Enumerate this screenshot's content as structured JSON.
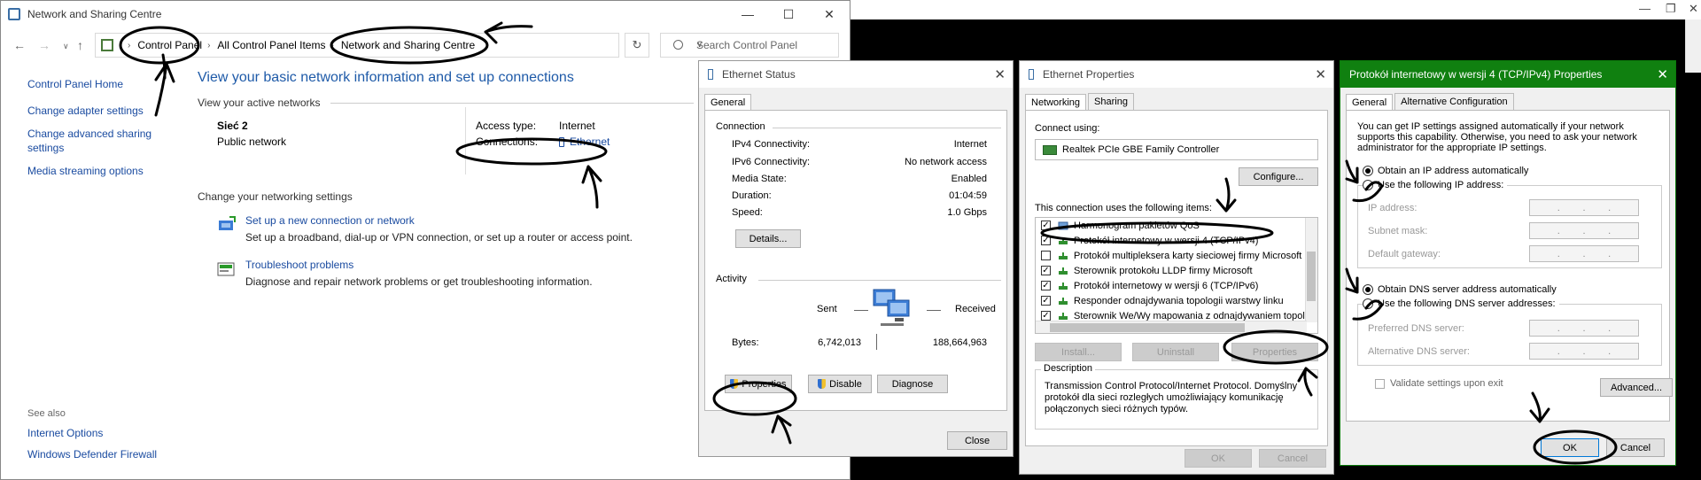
{
  "main_window": {
    "title": "Network and Sharing Centre",
    "breadcrumbs": [
      "Control Panel",
      "All Control Panel Items",
      "Network and Sharing Centre"
    ],
    "search_placeholder": "Search Control Panel",
    "left_links": [
      "Control Panel Home",
      "Change adapter settings",
      "Change advanced sharing settings",
      "Media streaming options"
    ],
    "see_also_label": "See also",
    "see_also_links": [
      "Internet Options",
      "Windows Defender Firewall"
    ],
    "heading": "View your basic network information and set up connections",
    "active_networks_label": "View your active networks",
    "network": {
      "name": "Sieć 2",
      "type": "Public network",
      "access_type_label": "Access type:",
      "access_type_value": "Internet",
      "connections_label": "Connections:",
      "connections_value": "Ethernet"
    },
    "change_label": "Change your networking settings",
    "tasks": [
      {
        "title": "Set up a new connection or network",
        "desc": "Set up a broadband, dial-up or VPN connection, or set up a router or access point."
      },
      {
        "title": "Troubleshoot problems",
        "desc": "Diagnose and repair network problems or get troubleshooting information."
      }
    ]
  },
  "ethernet_status": {
    "title": "Ethernet Status",
    "tab": "General",
    "connection_label": "Connection",
    "rows": [
      {
        "k": "IPv4 Connectivity:",
        "v": "Internet"
      },
      {
        "k": "IPv6 Connectivity:",
        "v": "No network access"
      },
      {
        "k": "Media State:",
        "v": "Enabled"
      },
      {
        "k": "Duration:",
        "v": "01:04:59"
      },
      {
        "k": "Speed:",
        "v": "1.0 Gbps"
      }
    ],
    "details_button": "Details...",
    "activity_label": "Activity",
    "sent_label": "Sent",
    "received_label": "Received",
    "bytes_label": "Bytes:",
    "bytes_sent": "6,742,013",
    "bytes_received": "188,664,963",
    "properties_button": "Properties",
    "disable_button": "Disable",
    "diagnose_button": "Diagnose",
    "close_button": "Close"
  },
  "ethernet_properties": {
    "title": "Ethernet Properties",
    "tabs": [
      "Networking",
      "Sharing"
    ],
    "connect_using_label": "Connect using:",
    "adapter": "Realtek PCIe GBE Family Controller",
    "configure_button": "Configure...",
    "items_label": "This connection uses the following items:",
    "items": [
      {
        "label": "Harmonogram pakietów QoS",
        "checked": true
      },
      {
        "label": "Protokół internetowy w wersji 4 (TCP/IPv4)",
        "checked": true
      },
      {
        "label": "Protokół multipleksera karty sieciowej firmy Microsoft",
        "checked": false
      },
      {
        "label": "Sterownik protokołu LLDP firmy Microsoft",
        "checked": true
      },
      {
        "label": "Protokół internetowy w wersji 6 (TCP/IPv6)",
        "checked": true
      },
      {
        "label": "Responder odnajdywania topologii warstwy linku",
        "checked": true
      },
      {
        "label": "Sterownik We/Wy mapowania z odnajdywaniem topolo",
        "checked": true
      }
    ],
    "install_button": "Install...",
    "uninstall_button": "Uninstall",
    "properties_button": "Properties",
    "description_label": "Description",
    "description": "Transmission Control Protocol/Internet Protocol. Domyślny protokół dla sieci rozległych umożliwiający komunikację połączonych sieci różnych typów.",
    "ok_button": "OK",
    "cancel_button": "Cancel"
  },
  "ipv4_properties": {
    "title": "Protokół internetowy w wersji 4 (TCP/IPv4) Properties",
    "tabs": [
      "General",
      "Alternative Configuration"
    ],
    "intro": "You can get IP settings assigned automatically if your network supports this capability. Otherwise, you need to ask your network administrator for the appropriate IP settings.",
    "obtain_ip_auto": "Obtain an IP address automatically",
    "use_following_ip": "Use the following IP address:",
    "ip_address_label": "IP address:",
    "subnet_mask_label": "Subnet mask:",
    "default_gateway_label": "Default gateway:",
    "obtain_dns_auto": "Obtain DNS server address automatically",
    "use_following_dns": "Use the following DNS server addresses:",
    "preferred_dns_label": "Preferred DNS server:",
    "alternative_dns_label": "Alternative DNS server:",
    "validate_label": "Validate settings upon exit",
    "advanced_button": "Advanced...",
    "ok_button": "OK",
    "cancel_button": "Cancel"
  }
}
